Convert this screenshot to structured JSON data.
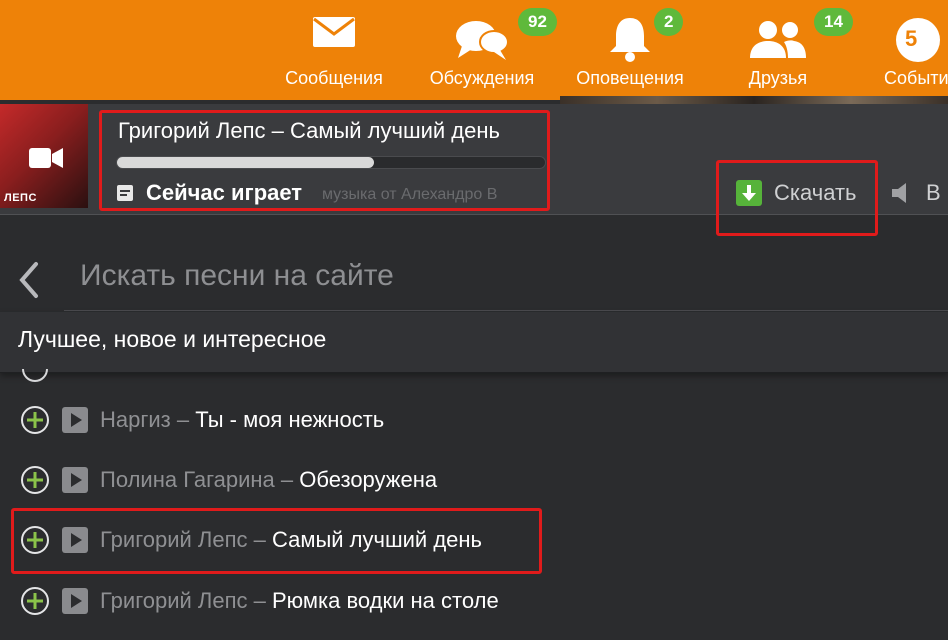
{
  "nav": {
    "items": [
      {
        "label": "Сообщения",
        "icon": "envelope-icon",
        "badge": ""
      },
      {
        "label": "Обсуждения",
        "icon": "chat-bubbles-icon",
        "badge": "92"
      },
      {
        "label": "Оповещения",
        "icon": "bell-icon",
        "badge": "2"
      },
      {
        "label": "Друзья",
        "icon": "friends-icon",
        "badge": "14"
      },
      {
        "label": "События",
        "icon": "events-icon",
        "badge": "5"
      }
    ]
  },
  "player": {
    "album_caption": "ЛЕПС",
    "track": "Григорий Лепс – Самый лучший день",
    "progress": 0.6,
    "status": "Сейчас играет",
    "source": "музыка от Алехандро В",
    "download_label": "Скачать",
    "volume_label": "В"
  },
  "search": {
    "placeholder": "Искать песни на сайте"
  },
  "section_title": "Лучшее, новое и интересное",
  "tracks": [
    {
      "artist": "Наргиз",
      "title": "Ты - моя нежность"
    },
    {
      "artist": "Полина Гагарина",
      "title": "Обезоружена"
    },
    {
      "artist": "Григорий Лепс",
      "title": "Самый лучший день"
    },
    {
      "artist": "Григорий Лепс",
      "title": "Рюмка водки на столе"
    }
  ],
  "colors": {
    "brand": "#ee8208",
    "badge": "#5fb93b",
    "highlight": "#e01b1b",
    "accent_green": "#8bc34a"
  }
}
